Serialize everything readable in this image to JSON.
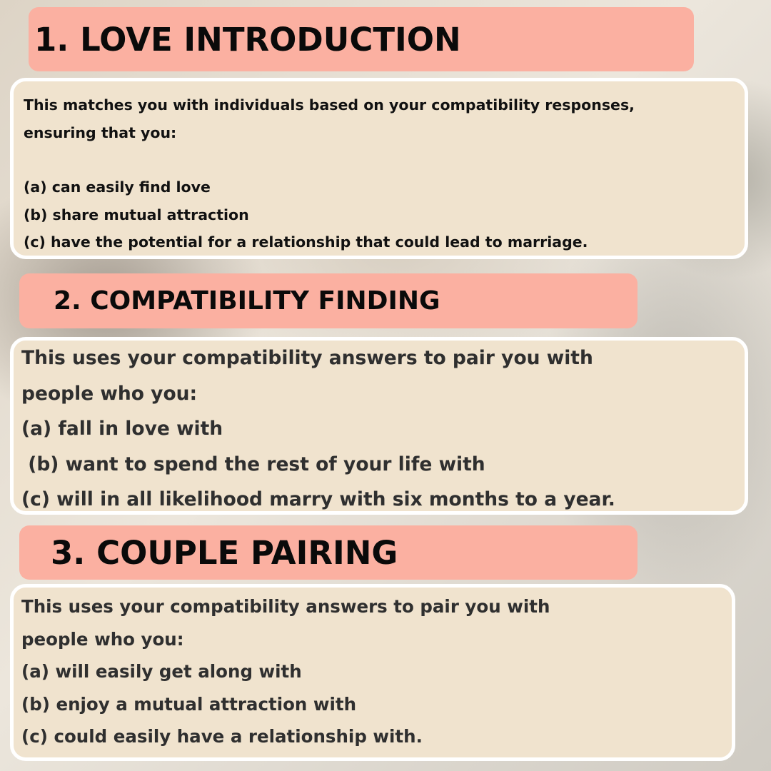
{
  "sections": [
    {
      "title": "1. LOVE INTRODUCTION",
      "lines": [
        "This matches you with individuals based on your compatibility responses,",
        "ensuring that you:",
        "(a) can easily find love",
        "(b) share mutual attraction",
        "(c) have the potential for a relationship that could lead to marriage."
      ]
    },
    {
      "title": "2. COMPATIBILITY FINDING",
      "lines": [
        "This uses your compatibility answers to pair you with",
        "people who you:",
        "(a) fall in love with",
        " (b) want to spend the rest of your life with",
        "(c) will in all likelihood marry with six months to a year."
      ]
    },
    {
      "title": "3. COUPLE PAIRING",
      "lines": [
        "This uses your compatibility answers to pair you with",
        "people who you:",
        "(a) will easily get along with",
        "(b) enjoy a mutual attraction with",
        "(c) could easily have a relationship with."
      ]
    }
  ],
  "colors": {
    "header_bg": "#fbb0a1",
    "card_bg": "#f0e3ce",
    "card_border": "#ffffff",
    "heading_text": "#0a0a0a",
    "body_text": "#2f2f2f"
  }
}
